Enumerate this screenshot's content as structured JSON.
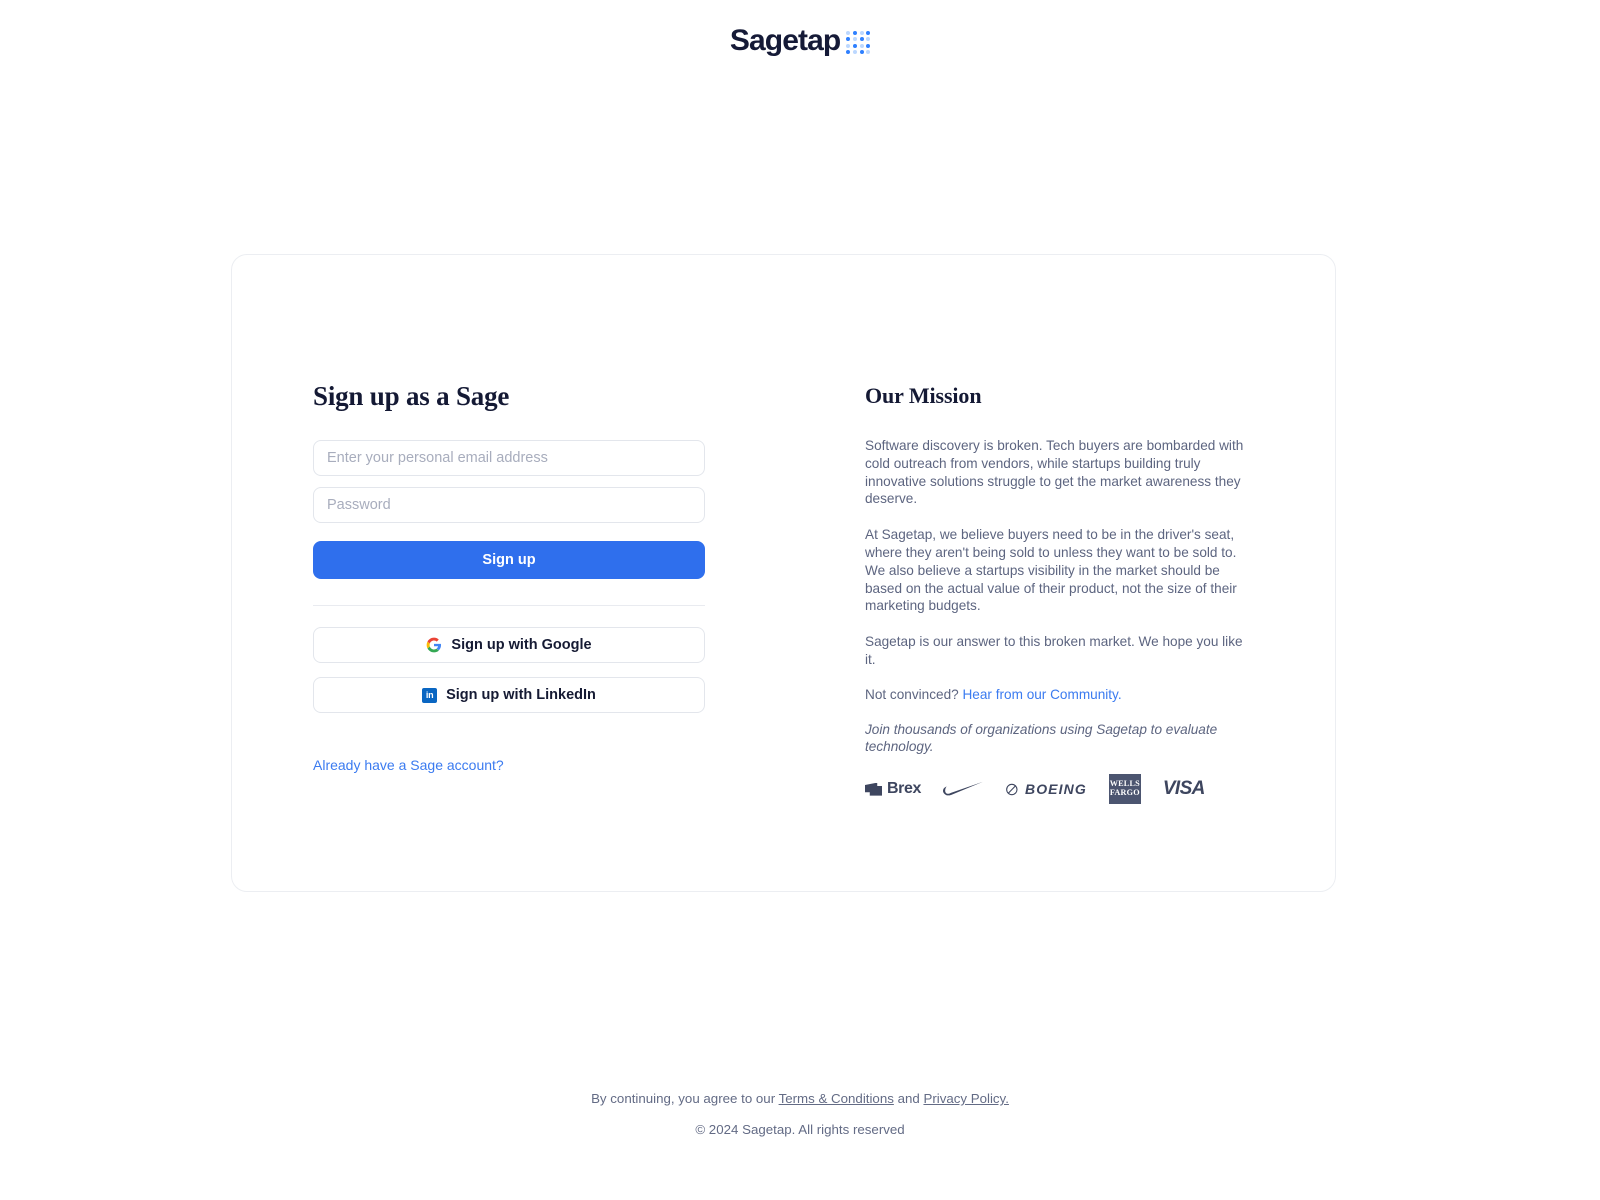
{
  "brand": {
    "name": "Sagetap",
    "logo_icon": "sagetap-dot-grid-icon",
    "accent_color": "#2f6fed",
    "dot_color": "#2f80ff"
  },
  "signup": {
    "title": "Sign up as a Sage",
    "email_placeholder": "Enter your personal email address",
    "email_value": "",
    "password_placeholder": "Password",
    "password_value": "",
    "submit_label": "Sign up",
    "google_label": "Sign up with Google",
    "google_icon": "google-g-icon",
    "linkedin_label": "Sign up with LinkedIn",
    "linkedin_icon": "linkedin-icon",
    "linkedin_glyph": "in",
    "account_link": "Already have a Sage account?"
  },
  "mission": {
    "title": "Our Mission",
    "paragraph_1": "Software discovery is broken. Tech buyers are bombarded with cold outreach from vendors, while startups building truly innovative solutions struggle to get the market awareness they deserve.",
    "paragraph_2": "At Sagetap, we believe buyers need to be in the driver's seat, where they aren't being sold to unless they want to be sold to. We also believe a startups visibility in the market should be based on the actual value of their product, not the size of their marketing budgets.",
    "paragraph_3": "Sagetap is our answer to this broken market. We hope you like it.",
    "not_convinced_prefix": "Not convinced? ",
    "community_link": "Hear from our Community.",
    "tagline": "Join thousands of organizations using Sagetap to evaluate technology.",
    "logos": [
      {
        "name": "Brex",
        "icon": "brex-logo"
      },
      {
        "name": "Nike",
        "icon": "nike-swoosh-logo"
      },
      {
        "name": "BOEING",
        "icon": "boeing-logo"
      },
      {
        "name": "WELLS FARGO",
        "line1": "WELLS",
        "line2": "FARGO",
        "icon": "wells-fargo-logo"
      },
      {
        "name": "VISA",
        "icon": "visa-logo"
      }
    ]
  },
  "footer": {
    "consent_prefix": "By continuing, you agree to our ",
    "terms_link": "Terms & Conditions",
    "consent_middle": " and ",
    "privacy_link": "Privacy Policy.",
    "copyright": "© 2024 Sagetap. All rights reserved"
  }
}
